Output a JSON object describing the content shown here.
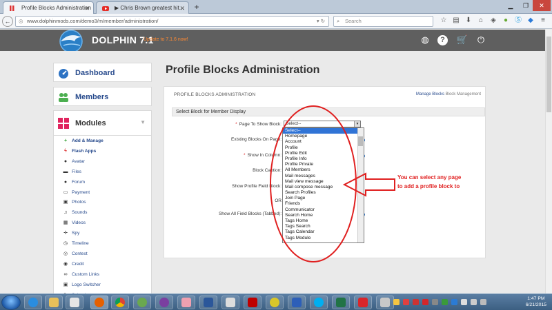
{
  "browser": {
    "tabs": [
      {
        "title": "Profile Blocks Administration",
        "active": true
      },
      {
        "title": "▶ Chris Brown greatest hit...",
        "active": false
      }
    ],
    "url": "www.dolphinmods.com/demo3/m/member/administration/",
    "search_placeholder": "Search"
  },
  "site": {
    "brand": "DOLPHIN 7.1",
    "update_link": "Update to 7.1.6 now!"
  },
  "sidebar": {
    "dashboard": "Dashboard",
    "members": "Members",
    "modules": "Modules",
    "items": [
      {
        "label": "Add & Manage",
        "icon": "plus-icon"
      },
      {
        "label": "Flash Apps",
        "icon": "bolt-icon"
      },
      {
        "label": "Avatar",
        "icon": "user-icon"
      },
      {
        "label": "Files",
        "icon": "file-icon"
      },
      {
        "label": "Forum",
        "icon": "comments-icon"
      },
      {
        "label": "Payment",
        "icon": "credit-card-icon"
      },
      {
        "label": "Photos",
        "icon": "photo-icon"
      },
      {
        "label": "Sounds",
        "icon": "music-icon"
      },
      {
        "label": "Videos",
        "icon": "film-icon"
      },
      {
        "label": "Spy",
        "icon": "crosshair-icon"
      },
      {
        "label": "Timeline",
        "icon": "clock-icon"
      },
      {
        "label": "Contest",
        "icon": "target-icon"
      },
      {
        "label": "Credit",
        "icon": "coin-icon"
      },
      {
        "label": "Custom Links",
        "icon": "link-icon"
      },
      {
        "label": "Logo Switcher",
        "icon": "image-icon"
      },
      {
        "label": "Schools",
        "icon": "pencil-icon"
      }
    ]
  },
  "main": {
    "page_title": "Profile Blocks Administration",
    "panel_title": "PROFILE BLOCKS ADMINISTRATION",
    "manage_blocks": "Manage Blocks",
    "block_management": "Block Management",
    "section_title": "Select Block for Member Display",
    "fields": {
      "page_to_show": "Page To Show Block:",
      "existing_blocks": "Existing Blocks On Page:",
      "show_in_column": "Show In Column:",
      "block_caption": "Block Caption:",
      "show_profile_field_block": "Show Profile Field Block:",
      "or": "OR",
      "show_all_field_blocks": "Show All Field Blocks (Tabbed):"
    },
    "select_value": "Select--",
    "dropdown_options": [
      "Select--",
      "Homepage",
      "Account",
      "Profile",
      "Profile Edit",
      "Profile Info",
      "Profile Private",
      "All Members",
      "Mail messages",
      "Mail view message",
      "Mail compose message",
      "Search Profiles",
      "Join Page",
      "Friends",
      "Communicator",
      "Search Home",
      "Tags Home",
      "Tags Search",
      "Tags Calendar",
      "Tags Module"
    ]
  },
  "annotation": {
    "line1": "You can select any page",
    "line2": "to add a profile block to"
  },
  "taskbar": {
    "time": "1:47 PM",
    "date": "6/21/2015"
  },
  "colors": {
    "accent_blue": "#274a8c",
    "annotation_red": "#e02020",
    "header_gray": "#5f5f5f",
    "update_orange": "#ff8a33"
  }
}
